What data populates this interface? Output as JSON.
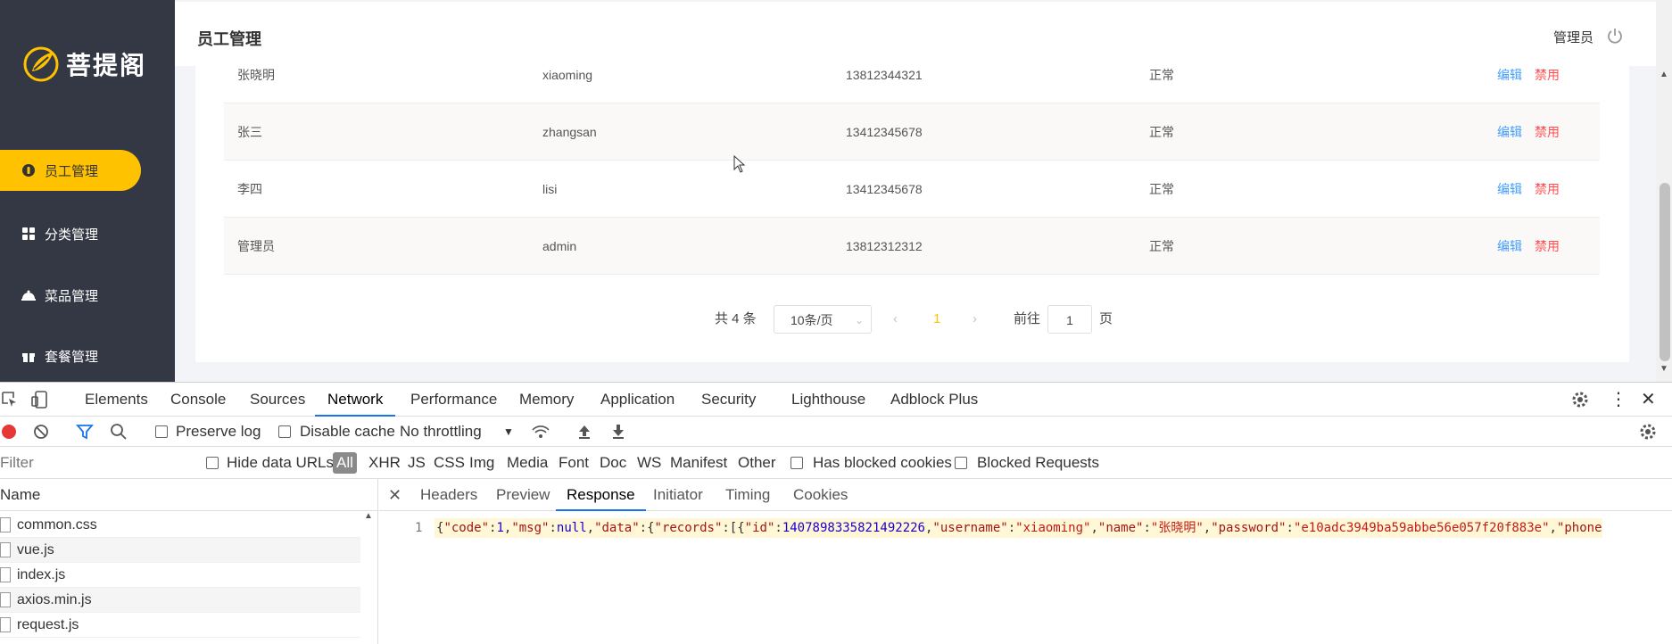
{
  "app": {
    "logo_text": "菩提阁",
    "nav": [
      {
        "label": "员工管理",
        "icon": "user-icon",
        "active": true
      },
      {
        "label": "分类管理",
        "icon": "grid-icon",
        "active": false
      },
      {
        "label": "菜品管理",
        "icon": "dish-icon",
        "active": false
      },
      {
        "label": "套餐管理",
        "icon": "gift-icon",
        "active": false
      }
    ],
    "header": {
      "title": "员工管理",
      "user": "管理员",
      "logout_icon": "power-icon"
    },
    "table": {
      "rows": [
        {
          "name": "张晓明",
          "username": "xiaoming",
          "phone": "13812344321",
          "status": "正常",
          "edit": "编辑",
          "disable": "禁用"
        },
        {
          "name": "张三",
          "username": "zhangsan",
          "phone": "13412345678",
          "status": "正常",
          "edit": "编辑",
          "disable": "禁用"
        },
        {
          "name": "李四",
          "username": "lisi",
          "phone": "13412345678",
          "status": "正常",
          "edit": "编辑",
          "disable": "禁用"
        },
        {
          "name": "管理员",
          "username": "admin",
          "phone": "13812312312",
          "status": "正常",
          "edit": "编辑",
          "disable": "禁用"
        }
      ]
    },
    "pagination": {
      "total": "共 4 条",
      "page_size": "10条/页",
      "current_page": "1",
      "goto_label": "前往",
      "goto_value": "1",
      "goto_suffix": "页"
    },
    "colors": {
      "sidebar": "#343744",
      "accent": "#ffc200",
      "edit": "#419eff",
      "disable": "#ff4d4d"
    }
  },
  "devtools": {
    "tabs": [
      "Elements",
      "Console",
      "Sources",
      "Network",
      "Performance",
      "Memory",
      "Application",
      "Security",
      "Lighthouse",
      "Adblock Plus"
    ],
    "active_tab": "Network",
    "toolbar": {
      "preserve_log": "Preserve log",
      "disable_cache": "Disable cache",
      "throttling": "No throttling"
    },
    "filter": {
      "placeholder": "Filter",
      "hide_data_urls": "Hide data URLs",
      "types": [
        "All",
        "XHR",
        "JS",
        "CSS",
        "Img",
        "Media",
        "Font",
        "Doc",
        "WS",
        "Manifest",
        "Other"
      ],
      "has_blocked_cookies": "Has blocked cookies",
      "blocked_requests": "Blocked Requests"
    },
    "name_header": "Name",
    "files": [
      "common.css",
      "vue.js",
      "index.js",
      "axios.min.js",
      "request.js"
    ],
    "detail_tabs": [
      "Headers",
      "Preview",
      "Response",
      "Initiator",
      "Timing",
      "Cookies"
    ],
    "active_detail_tab": "Response",
    "response": {
      "line_number": "1",
      "tokens": [
        {
          "t": "p",
          "v": "{"
        },
        {
          "t": "k",
          "v": "\"code\""
        },
        {
          "t": "p",
          "v": ":"
        },
        {
          "t": "n",
          "v": "1"
        },
        {
          "t": "p",
          "v": ","
        },
        {
          "t": "k",
          "v": "\"msg\""
        },
        {
          "t": "p",
          "v": ":"
        },
        {
          "t": "n",
          "v": "null"
        },
        {
          "t": "p",
          "v": ","
        },
        {
          "t": "k",
          "v": "\"data\""
        },
        {
          "t": "p",
          "v": ":{"
        },
        {
          "t": "k",
          "v": "\"records\""
        },
        {
          "t": "p",
          "v": ":[{"
        },
        {
          "t": "k",
          "v": "\"id\""
        },
        {
          "t": "p",
          "v": ":"
        },
        {
          "t": "n",
          "v": "1407898335821492226"
        },
        {
          "t": "p",
          "v": ","
        },
        {
          "t": "k",
          "v": "\"username\""
        },
        {
          "t": "p",
          "v": ":"
        },
        {
          "t": "s",
          "v": "\"xiaoming\""
        },
        {
          "t": "p",
          "v": ","
        },
        {
          "t": "k",
          "v": "\"name\""
        },
        {
          "t": "p",
          "v": ":"
        },
        {
          "t": "s",
          "v": "\"张晓明\""
        },
        {
          "t": "p",
          "v": ","
        },
        {
          "t": "k",
          "v": "\"password\""
        },
        {
          "t": "p",
          "v": ":"
        },
        {
          "t": "s",
          "v": "\"e10adc3949ba59abbe56e057f20f883e\""
        },
        {
          "t": "p",
          "v": ","
        },
        {
          "t": "k",
          "v": "\"phone"
        }
      ]
    }
  }
}
